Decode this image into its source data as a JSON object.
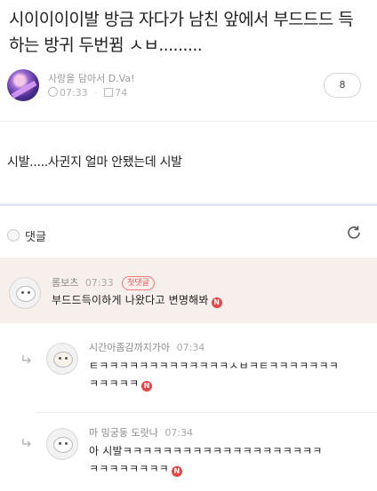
{
  "post": {
    "title": "시이이이이발 방금 자다가 남친 앞에서 부드드드 득하는 방귀 두번뀜 ㅅㅂ.........",
    "author": "사랑을 담아서 D.Va!",
    "time": "07:33",
    "views": "74",
    "comment_count": "8",
    "body": "시발.....사귄지 얼마 안됐는데 시발"
  },
  "comments_section": {
    "label": "댓글",
    "comments": [
      {
        "name": "롬보츠",
        "time": "07:33",
        "badge": "첫댓글",
        "text": "부드드득이하게 나왔다고 변명해봐",
        "new_label": "N"
      }
    ],
    "replies": [
      {
        "name": "시간아좀감까지가아",
        "time": "07:34",
        "line1": "ㅌㅋㅋㅋㅋㅋㅋㅋㅋㅋㅋㅋㅋㅋㅅㅂㅋㅌㅋㅋㅋㅋㅋㅋㅋ",
        "line2": "ㅋㅋㅋㅋㅋ",
        "new_label": "N"
      },
      {
        "name": "마 밍궁둥 도랏나",
        "time": "07:34",
        "line1": "아 시발ㅋㅋㅋㅋㅋㅋㅋㅋㅋㅋㅋㅋㅋㅋㅋㅋㅋㅋㅋㅋ",
        "line2": "ㅋㅋㅋㅋㅋㅋㅋㅋ",
        "new_label": "N"
      }
    ]
  },
  "icons": {
    "clock": "clock-icon",
    "views": "views-icon",
    "bell": "bell-icon",
    "refresh": "refresh-icon",
    "reply": "reply-arrow-icon",
    "new": "new-badge-icon"
  },
  "colors": {
    "highlight_bg": "#f7efec",
    "badge_red": "#e55555",
    "new_icon": "#e64545",
    "divider": "#dde6ee"
  }
}
